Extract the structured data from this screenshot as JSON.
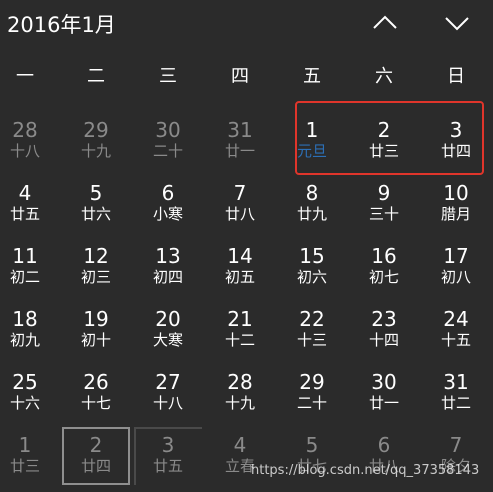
{
  "header": {
    "title": "2016年1月",
    "prev_icon": "chevron-up-icon",
    "next_icon": "chevron-down-icon"
  },
  "weekdays": [
    "一",
    "二",
    "三",
    "四",
    "五",
    "六",
    "日"
  ],
  "weeks": [
    [
      {
        "day": "28",
        "lunar": "十八",
        "other": true
      },
      {
        "day": "29",
        "lunar": "十九",
        "other": true
      },
      {
        "day": "30",
        "lunar": "二十",
        "other": true
      },
      {
        "day": "31",
        "lunar": "廿一",
        "other": true
      },
      {
        "day": "1",
        "lunar": "元旦",
        "other": false,
        "accent": true
      },
      {
        "day": "2",
        "lunar": "廿三",
        "other": false
      },
      {
        "day": "3",
        "lunar": "廿四",
        "other": false
      }
    ],
    [
      {
        "day": "4",
        "lunar": "廿五",
        "other": false
      },
      {
        "day": "5",
        "lunar": "廿六",
        "other": false
      },
      {
        "day": "6",
        "lunar": "小寒",
        "other": false
      },
      {
        "day": "7",
        "lunar": "廿八",
        "other": false
      },
      {
        "day": "8",
        "lunar": "廿九",
        "other": false
      },
      {
        "day": "9",
        "lunar": "三十",
        "other": false
      },
      {
        "day": "10",
        "lunar": "腊月",
        "other": false
      }
    ],
    [
      {
        "day": "11",
        "lunar": "初二",
        "other": false
      },
      {
        "day": "12",
        "lunar": "初三",
        "other": false
      },
      {
        "day": "13",
        "lunar": "初四",
        "other": false
      },
      {
        "day": "14",
        "lunar": "初五",
        "other": false
      },
      {
        "day": "15",
        "lunar": "初六",
        "other": false
      },
      {
        "day": "16",
        "lunar": "初七",
        "other": false
      },
      {
        "day": "17",
        "lunar": "初八",
        "other": false
      }
    ],
    [
      {
        "day": "18",
        "lunar": "初九",
        "other": false
      },
      {
        "day": "19",
        "lunar": "初十",
        "other": false
      },
      {
        "day": "20",
        "lunar": "大寒",
        "other": false
      },
      {
        "day": "21",
        "lunar": "十二",
        "other": false
      },
      {
        "day": "22",
        "lunar": "十三",
        "other": false
      },
      {
        "day": "23",
        "lunar": "十四",
        "other": false
      },
      {
        "day": "24",
        "lunar": "十五",
        "other": false
      }
    ],
    [
      {
        "day": "25",
        "lunar": "十六",
        "other": false
      },
      {
        "day": "26",
        "lunar": "十七",
        "other": false
      },
      {
        "day": "27",
        "lunar": "十八",
        "other": false
      },
      {
        "day": "28",
        "lunar": "十九",
        "other": false
      },
      {
        "day": "29",
        "lunar": "二十",
        "other": false
      },
      {
        "day": "30",
        "lunar": "廿一",
        "other": false
      },
      {
        "day": "31",
        "lunar": "廿二",
        "other": false
      }
    ],
    [
      {
        "day": "1",
        "lunar": "廿三",
        "other": true
      },
      {
        "day": "2",
        "lunar": "廿四",
        "other": true
      },
      {
        "day": "3",
        "lunar": "廿五",
        "other": true
      },
      {
        "day": "4",
        "lunar": "立春",
        "other": true
      },
      {
        "day": "5",
        "lunar": "廿七",
        "other": true
      },
      {
        "day": "6",
        "lunar": "廿八",
        "other": true
      },
      {
        "day": "7",
        "lunar": "除夕",
        "other": true
      }
    ]
  ],
  "watermark": "https://blog.csdn.net/qq_37358143",
  "colors": {
    "background": "#2b2b2b",
    "highlight": "#e0352b",
    "accent_lunar": "#2c6fb6",
    "muted": "#8a8a8a"
  }
}
